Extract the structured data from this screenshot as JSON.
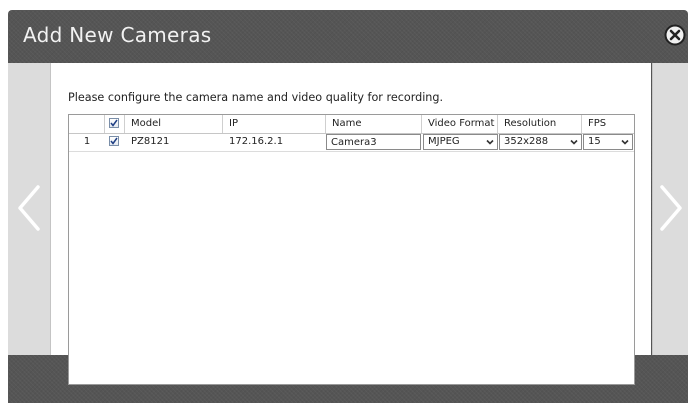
{
  "dialog": {
    "title": "Add New Cameras",
    "instruction": "Please configure the camera name and video quality for recording."
  },
  "icons": {
    "close": "close-circle-x-icon",
    "prev": "chevron-left-icon",
    "next": "chevron-right-icon",
    "dropdown": "chevron-down-icon",
    "check": "checkmark-icon"
  },
  "table": {
    "header_checkbox_checked": true,
    "columns": [
      "",
      "",
      "Model",
      "IP",
      "Name",
      "Video Format",
      "Resolution",
      "FPS"
    ],
    "rows": [
      {
        "index": "1",
        "checked": true,
        "model": "PZ8121",
        "ip": "172.16.2.1",
        "name": "Camera3",
        "video_format": "MJPEG",
        "resolution": "352x288",
        "fps": "15"
      }
    ]
  },
  "colors": {
    "frame": "#555555",
    "side_panel": "#dcdcdc",
    "content": "#ffffff",
    "title_text": "#f2f2f2"
  }
}
